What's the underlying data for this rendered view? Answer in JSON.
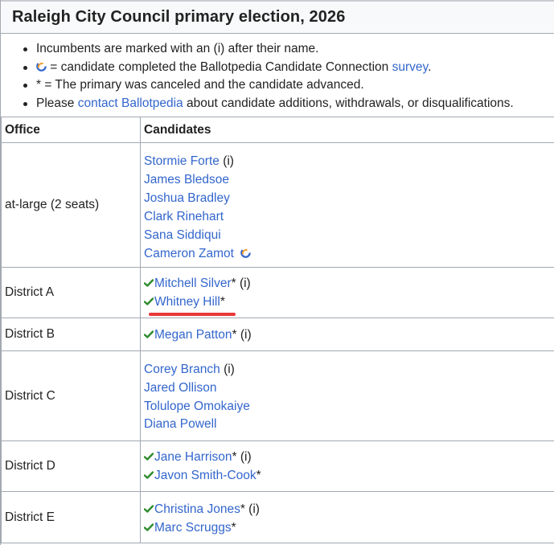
{
  "title": "Raleigh City Council primary election, 2026",
  "notes": {
    "incumbent": "Incumbents are marked with an (i) after their name.",
    "cc_text": " = candidate completed the Ballotpedia Candidate Connection ",
    "cc_link": "survey",
    "cc_end": ".",
    "canceled": "* = The primary was canceled and the candidate advanced.",
    "contact_pre": "Please ",
    "contact_link": "contact Ballotpedia",
    "contact_post": " about candidate additions, withdrawals, or disqualifications."
  },
  "table": {
    "col_office": "Office",
    "col_candidates": "Candidates",
    "rows": [
      {
        "office": "at-large (2 seats)",
        "candidates": [
          {
            "name": "Stormie Forte",
            "suffix": " (i)"
          },
          {
            "name": "James Bledsoe",
            "suffix": ""
          },
          {
            "name": "Joshua Bradley",
            "suffix": ""
          },
          {
            "name": "Clark Rinehart",
            "suffix": ""
          },
          {
            "name": "Sana Siddiqui",
            "suffix": ""
          },
          {
            "name": "Cameron Zamot",
            "suffix": ""
          }
        ]
      },
      {
        "office": "District A",
        "candidates": [
          {
            "name": "Mitchell Silver",
            "suffix": "* (i)"
          },
          {
            "name": "Whitney Hill",
            "suffix": "*"
          }
        ]
      },
      {
        "office": "District B",
        "candidates": [
          {
            "name": "Megan Patton",
            "suffix": "* (i)"
          }
        ]
      },
      {
        "office": "District C",
        "candidates": [
          {
            "name": "Corey Branch",
            "suffix": " (i)"
          },
          {
            "name": "Jared Ollison",
            "suffix": ""
          },
          {
            "name": "Tolulope Omokaiye",
            "suffix": ""
          },
          {
            "name": "Diana Powell",
            "suffix": ""
          }
        ]
      },
      {
        "office": "District D",
        "candidates": [
          {
            "name": "Jane Harrison",
            "suffix": "* (i)"
          },
          {
            "name": "Javon Smith-Cook",
            "suffix": "*"
          }
        ]
      },
      {
        "office": "District E",
        "candidates": [
          {
            "name": "Christina Jones",
            "suffix": "* (i)"
          },
          {
            "name": "Marc Scruggs",
            "suffix": "*"
          }
        ]
      }
    ]
  },
  "colors": {
    "link": "#3366cc",
    "check": "#2e8b2e",
    "annotation": "#e8373a",
    "border": "#a2a9b1"
  },
  "icons": {
    "candidate_connection": "candidate-connection-icon",
    "advanced": "checkmark-icon"
  }
}
